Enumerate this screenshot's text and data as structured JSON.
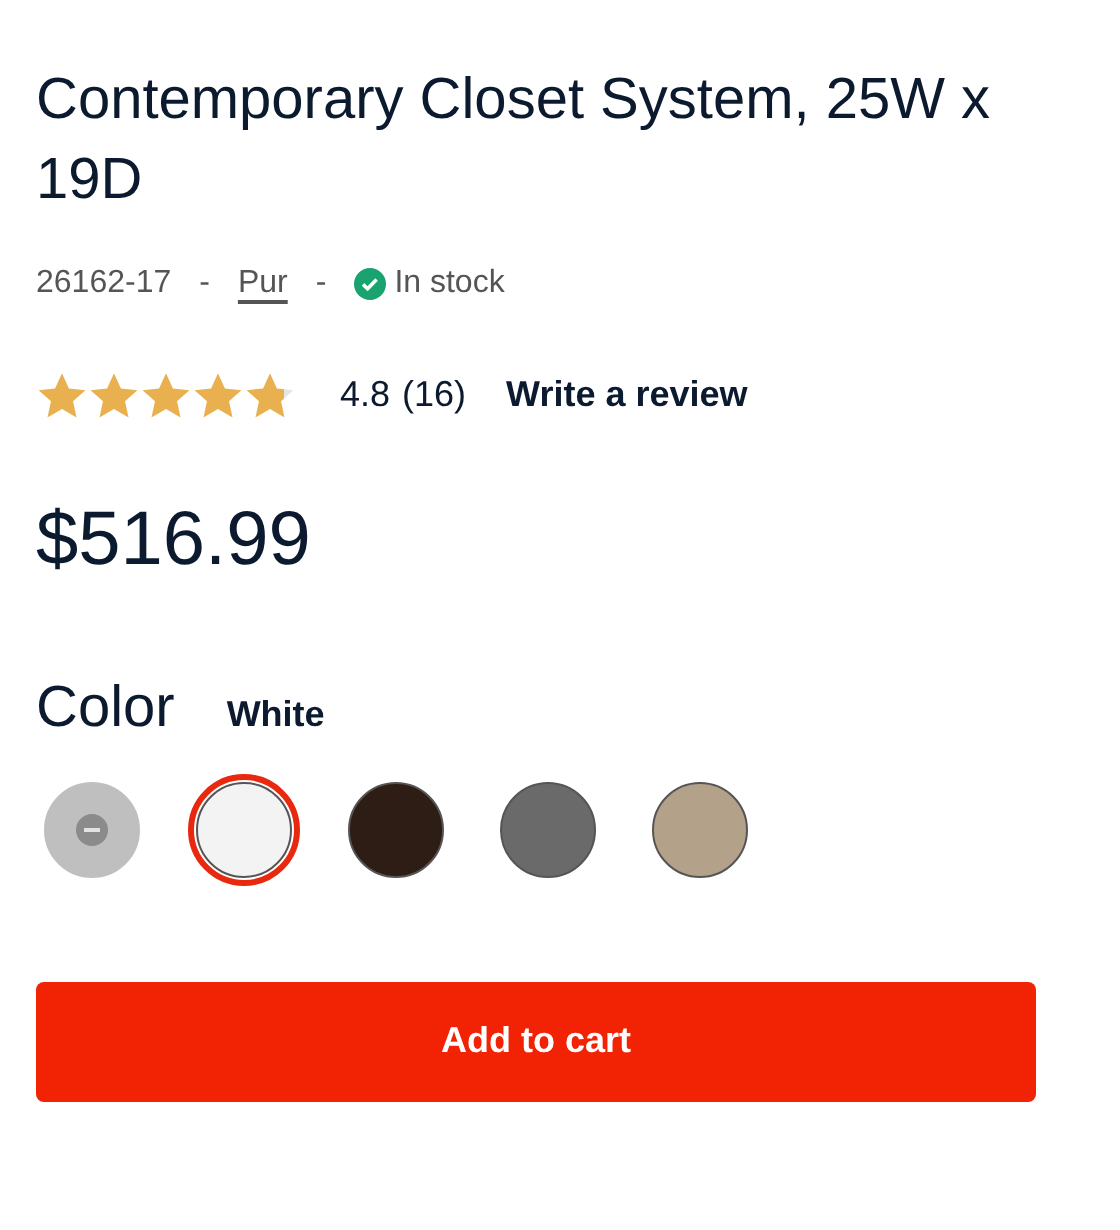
{
  "title": "Contemporary Closet System, 25W x 19D",
  "meta": {
    "sku": "26162-17",
    "separator_1": "-",
    "brand": "Pur",
    "separator_2": "-",
    "stock": "In stock",
    "in_stock": true
  },
  "rating": {
    "stars": 4.8,
    "score": "4.8",
    "count": "(16)",
    "review_link": "Write a review"
  },
  "price": "$516.99",
  "color": {
    "label": "Color",
    "value": "White",
    "swatches": [
      {
        "color": "#b4b4b4",
        "unavailable": true,
        "selected": false
      },
      {
        "color": "#f3f3f3",
        "unavailable": false,
        "selected": true
      },
      {
        "color": "#2e1d14",
        "unavailable": false,
        "selected": false
      },
      {
        "color": "#6a6a6a",
        "unavailable": false,
        "selected": false
      },
      {
        "color": "#b3a18a",
        "unavailable": false,
        "selected": false
      }
    ]
  },
  "add_to_cart": "Add to cart"
}
